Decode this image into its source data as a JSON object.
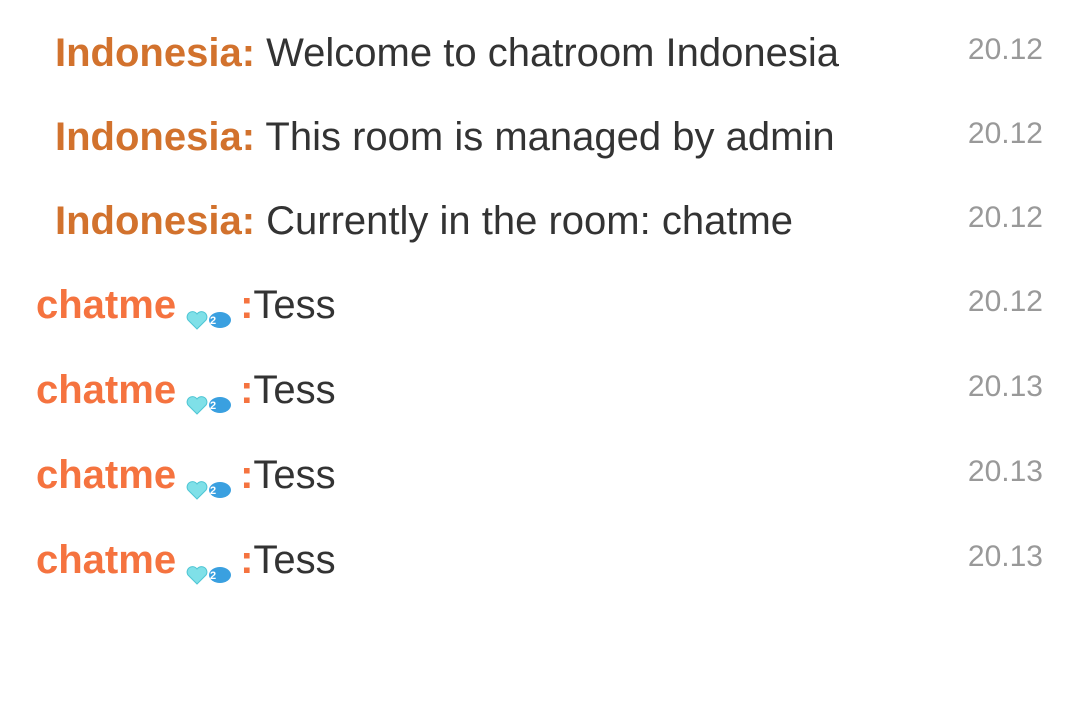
{
  "messages": [
    {
      "sender": "Indonesia:",
      "text": " Welcome to chatroom Indonesia",
      "time": "20.12"
    },
    {
      "sender": "Indonesia:",
      "text": " This room is managed by admin",
      "time": "20.12"
    },
    {
      "sender": "Indonesia:",
      "text": " Currently in the room: chatme",
      "time": "20.12"
    },
    {
      "sender": "chatme",
      "separator": ":",
      "text": "Tess",
      "time": "20.12",
      "badge_icon": "level-badge-icon",
      "badge_level": "2"
    },
    {
      "sender": "chatme",
      "separator": ":",
      "text": "Tess",
      "time": "20.13",
      "badge_icon": "level-badge-icon",
      "badge_level": "2"
    },
    {
      "sender": "chatme",
      "separator": ":",
      "text": "Tess",
      "time": "20.13",
      "badge_icon": "level-badge-icon",
      "badge_level": "2"
    },
    {
      "sender": "chatme",
      "separator": ":",
      "text": "Tess",
      "time": "20.13",
      "badge_icon": "level-badge-icon",
      "badge_level": "2"
    }
  ],
  "colors": {
    "system_sender": "#d2722d",
    "user_sender": "#f5733f",
    "message_text": "#333333",
    "timestamp": "#999999",
    "badge_heart": "#7fe0e8",
    "badge_bubble": "#3aa0e0"
  }
}
